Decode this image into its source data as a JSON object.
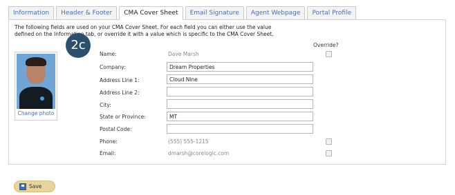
{
  "tabs": [
    {
      "label": "Information"
    },
    {
      "label": "Header & Footer"
    },
    {
      "label": "CMA Cover Sheet",
      "active": true
    },
    {
      "label": "Email Signature"
    },
    {
      "label": "Agent Webpage"
    },
    {
      "label": "Portal Profile"
    }
  ],
  "intro": {
    "line1": "The following fields are used on your CMA Cover Sheet. For each field you can either use the value",
    "line2": "defined on the Information tab, or override it with a value which is specific to the CMA Cover Sheet."
  },
  "badge": "2c",
  "photo": {
    "change_label": "Change photo"
  },
  "override_header": "Override?",
  "fields": [
    {
      "label": "Name:",
      "value": "Dave Marsh",
      "kind": "static",
      "override": true
    },
    {
      "label": "Company:",
      "value": "Dream Properties",
      "kind": "input"
    },
    {
      "label": "Address Line 1:",
      "value": "Cloud Nine",
      "kind": "input"
    },
    {
      "label": "Address Line 2:",
      "value": "",
      "kind": "input"
    },
    {
      "label": "City:",
      "value": "",
      "kind": "input"
    },
    {
      "label": "State or Province:",
      "value": "MT",
      "kind": "input"
    },
    {
      "label": "Postal Code:",
      "value": "",
      "kind": "input"
    },
    {
      "label": "Phone:",
      "value": "(555) 555-1215",
      "kind": "static",
      "override": true
    },
    {
      "label": "Email:",
      "value": "dmarsh@corelogic.com",
      "kind": "static",
      "override": true
    }
  ],
  "save_label": "Save",
  "colors": {
    "link": "#4a6fb0",
    "badge": "#2c4f6e",
    "save_button": "#e9d49b"
  }
}
